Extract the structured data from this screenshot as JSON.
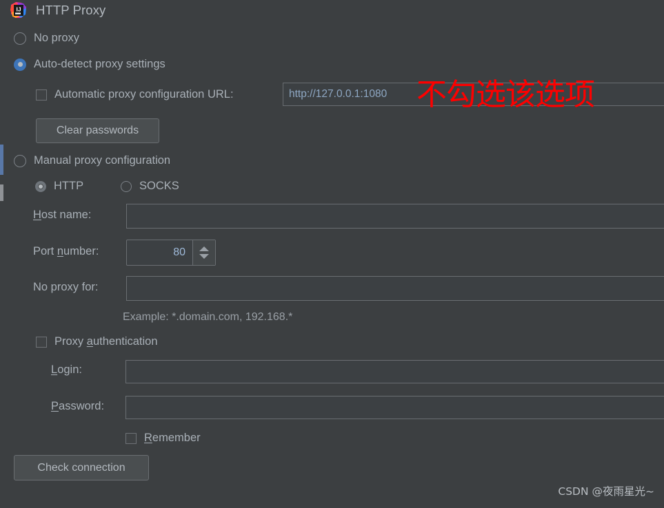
{
  "window": {
    "title": "HTTP Proxy",
    "app_icon": "intellij-idea-icon",
    "background_color": "#3c3f41",
    "accent_color": "#3d74b8"
  },
  "proxy_mode": {
    "options": [
      {
        "label": "No proxy",
        "selected": false
      },
      {
        "label": "Auto-detect proxy settings",
        "selected": true
      },
      {
        "label": "Manual proxy configuration",
        "selected": false
      }
    ]
  },
  "auto_detect": {
    "pac_checkbox_label": "Automatic proxy configuration URL:",
    "pac_checkbox_checked": false,
    "pac_url_value": "http://127.0.0.1:1080",
    "clear_passwords_label": "Clear passwords"
  },
  "manual": {
    "protocol": {
      "http_label": "HTTP",
      "http_selected": true,
      "socks_label": "SOCKS",
      "socks_selected": false
    },
    "host_name_label": "Host name:",
    "host_name_value": "",
    "port_number_label": "Port number:",
    "port_number_value": "80",
    "no_proxy_for_label": "No proxy for:",
    "no_proxy_for_value": "",
    "example_hint": "Example: *.domain.com, 192.168.*",
    "proxy_auth_label": "Proxy authentication",
    "proxy_auth_checked": false,
    "login_label": "Login:",
    "login_value": "",
    "password_label": "Password:",
    "password_value": "",
    "remember_label": "Remember",
    "remember_checked": false
  },
  "actions": {
    "check_connection_label": "Check connection"
  },
  "annotation": {
    "text": "不勾选该选项",
    "color": "#fe0000"
  },
  "watermark": {
    "text": "CSDN @夜雨星光~"
  }
}
